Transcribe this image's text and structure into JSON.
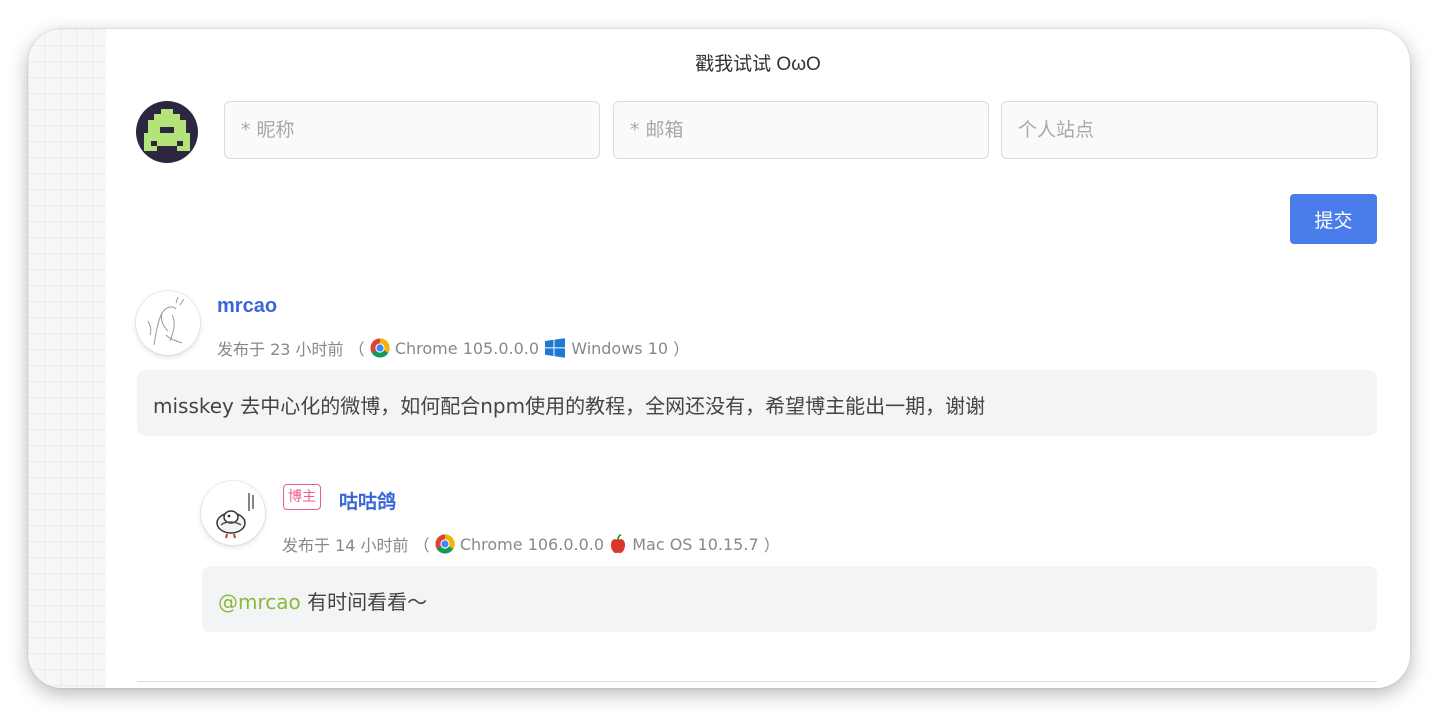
{
  "form": {
    "prompt": "戳我试试 OωO",
    "nickname_placeholder": "* 昵称",
    "email_placeholder": "* 邮箱",
    "site_placeholder": "个人站点",
    "submit_label": "提交"
  },
  "comments": [
    {
      "author": "mrcao",
      "time": "发布于 23 小时前",
      "browser": "Chrome 105.0.0.0",
      "os": "Windows 10",
      "content": "misskey 去中心化的微博，如何配合npm使用的教程，全网还没有，希望博主能出一期，谢谢"
    }
  ],
  "replies": [
    {
      "badge": "博主",
      "author": "咕咕鸽",
      "time": "发布于 14 小时前",
      "browser": "Chrome 106.0.0.0",
      "os": "Mac OS 10.15.7",
      "mention": "@mrcao",
      "content": "有时间看看～"
    }
  ],
  "colors": {
    "accent": "#4a7de9",
    "nickname": "#3a67d8",
    "badge": "#e8618c",
    "mention": "#8bb93c"
  },
  "icons": [
    "invader-avatar-icon",
    "chrome-icon",
    "windows-icon",
    "apple-icon"
  ]
}
